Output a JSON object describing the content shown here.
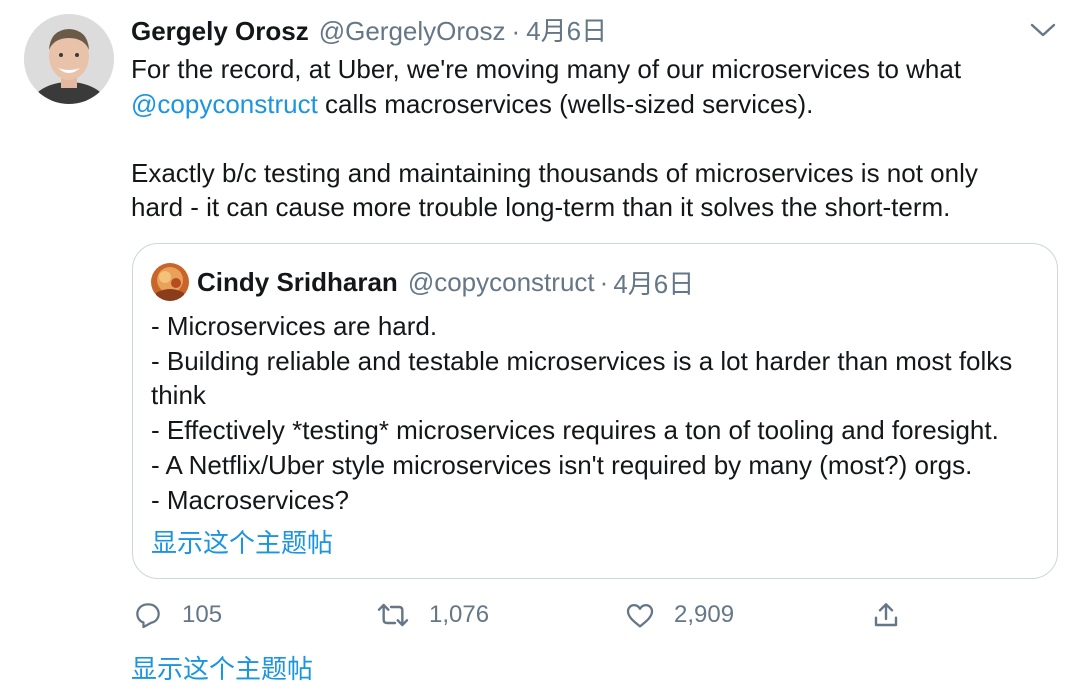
{
  "tweet": {
    "author_name": "Gergely Orosz",
    "author_handle": "@GergelyOrosz",
    "separator": "·",
    "date": "4月6日",
    "text": {
      "line1": "For the record, at Uber, we're moving many of our microservices to what",
      "mention": "@copyconstruct",
      "line2_rest": " calls macroservices (wells-sized services).",
      "para2_line1": "Exactly b/c testing and maintaining thousands of microservices is not only",
      "para2_line2": "hard - it can cause more trouble long-term than it solves the short-term."
    }
  },
  "quote": {
    "author_name": "Cindy Sridharan",
    "author_handle": "@copyconstruct",
    "separator": "·",
    "date": "4月6日",
    "lines": [
      "- Microservices are hard.",
      "- Building reliable and testable microservices is a lot harder than most folks",
      "think",
      "- Effectively *testing* microservices requires a ton of tooling and foresight.",
      "- A Netflix/Uber style microservices isn't required by many (most?) orgs.",
      "- Macroservices?"
    ],
    "show_thread": "显示这个主题帖"
  },
  "actions": {
    "reply_count": "105",
    "retweet_count": "1,076",
    "like_count": "2,909"
  },
  "show_thread": "显示这个主题帖",
  "icons": {
    "menu": "chevron-down-icon",
    "reply": "reply-icon",
    "retweet": "retweet-icon",
    "like": "heart-icon",
    "share": "share-icon"
  },
  "colors": {
    "link": "#1b95e0",
    "secondary": "#657786",
    "border": "#ccd6dd",
    "text": "#14171a"
  }
}
